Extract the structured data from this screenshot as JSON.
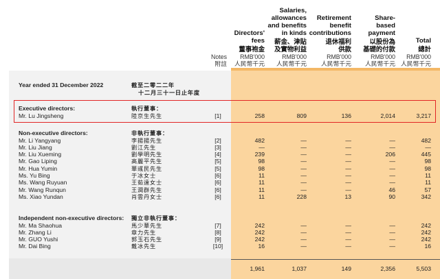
{
  "headers": {
    "notes_en": "Notes",
    "notes_cn": "附註",
    "columns": [
      {
        "en_lines": [
          "Directors'",
          "fees"
        ],
        "cn_lines": [
          "董事袍金"
        ],
        "unit_en": "RMB'000",
        "unit_cn": "人民幣千元"
      },
      {
        "en_lines": [
          "Salaries,",
          "allowances",
          "and benefits",
          "in kinds"
        ],
        "cn_lines": [
          "薪金、津貼",
          "及實物利益"
        ],
        "unit_en": "RMB'000",
        "unit_cn": "人民幣千元"
      },
      {
        "en_lines": [
          "Retirement",
          "benefit",
          "contributions"
        ],
        "cn_lines": [
          "退休福利",
          "供款"
        ],
        "unit_en": "RMB'000",
        "unit_cn": "人民幣千元"
      },
      {
        "en_lines": [
          "Share-",
          "based",
          "payment"
        ],
        "cn_lines": [
          "以股份為",
          "基礎的付款"
        ],
        "unit_en": "RMB'000",
        "unit_cn": "人民幣千元"
      },
      {
        "en_lines": [
          "Total"
        ],
        "cn_lines": [
          "總計"
        ],
        "unit_en": "RMB'000",
        "unit_cn": "人民幣千元"
      }
    ]
  },
  "period": {
    "en": "Year ended 31 December 2022",
    "cn_line1": "截至二零二二年",
    "cn_line2": "十二月三十一日止年度"
  },
  "executive": {
    "title_en": "Executive directors:",
    "title_cn": "執行董事：",
    "rows": [
      {
        "en": "Mr. Lu Jingsheng",
        "cn": "陸京生先生",
        "note": "[1]",
        "v": [
          "258",
          "809",
          "136",
          "2,014",
          "3,217"
        ]
      }
    ]
  },
  "non_executive": {
    "title_en": "Non-executive directors:",
    "title_cn": "非執行董事：",
    "rows": [
      {
        "en": "Mr. Li Yangyang",
        "cn": "李揚揚先生",
        "note": "[2]",
        "v": [
          "482",
          "—",
          "—",
          "—",
          "482"
        ]
      },
      {
        "en": "Mr. Liu Jiang",
        "cn": "劉江先生",
        "note": "[3]",
        "v": [
          "—",
          "—",
          "—",
          "—",
          "—"
        ]
      },
      {
        "en": "Mr. Liu Xueming",
        "cn": "劉學明先生",
        "note": "[4]",
        "v": [
          "239",
          "—",
          "—",
          "206",
          "445"
        ]
      },
      {
        "en": "Mr. Gao Liping",
        "cn": "高麗平先生",
        "note": "[5]",
        "v": [
          "98",
          "—",
          "—",
          "—",
          "98"
        ]
      },
      {
        "en": "Mr. Hua Yumin",
        "cn": "華彧民先生",
        "note": "[5]",
        "v": [
          "98",
          "—",
          "—",
          "—",
          "98"
        ]
      },
      {
        "en": "Ms. Yu Bing",
        "cn": "于冰女士",
        "note": "[6]",
        "v": [
          "11",
          "—",
          "—",
          "—",
          "11"
        ]
      },
      {
        "en": "Ms. Wang Ruyuan",
        "cn": "王茹遠女士",
        "note": "[6]",
        "v": [
          "11",
          "—",
          "—",
          "—",
          "11"
        ]
      },
      {
        "en": "Mr. Wang Runqun",
        "cn": "王潤群先生",
        "note": "[6]",
        "v": [
          "11",
          "—",
          "—",
          "46",
          "57"
        ]
      },
      {
        "en": "Ms. Xiao Yundan",
        "cn": "肖雲丹女士",
        "note": "[6]",
        "v": [
          "11",
          "228",
          "13",
          "90",
          "342"
        ]
      }
    ]
  },
  "independent": {
    "title_en": "Independent non-executive directors:",
    "title_cn": "獨立非執行董事：",
    "rows": [
      {
        "en": "Mr. Ma Shaohua",
        "cn": "馬少華先生",
        "note": "[7]",
        "v": [
          "242",
          "—",
          "—",
          "—",
          "242"
        ]
      },
      {
        "en": "Mr. Zhang Li",
        "cn": "章力先生",
        "note": "[8]",
        "v": [
          "242",
          "—",
          "—",
          "—",
          "242"
        ]
      },
      {
        "en": "Mr. GUO Yushi",
        "cn": "郭玉石先生",
        "note": "[9]",
        "v": [
          "242",
          "—",
          "—",
          "—",
          "242"
        ]
      },
      {
        "en": "Mr. Dai Bing",
        "cn": "戴冰先生",
        "note": "[10]",
        "v": [
          "16",
          "—",
          "—",
          "—",
          "16"
        ]
      }
    ]
  },
  "totals": [
    "1,961",
    "1,037",
    "149",
    "2,356",
    "5,503"
  ],
  "colors": {
    "shade": "#fbd59e",
    "highlight_box": "#e12424"
  }
}
